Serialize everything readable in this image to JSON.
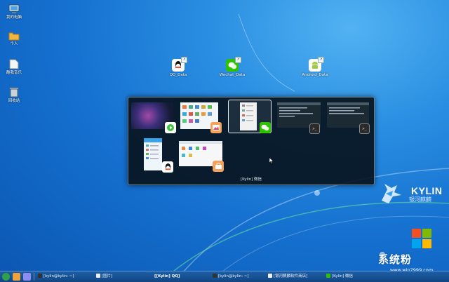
{
  "desktop": {
    "icons": [
      {
        "label": "我的电脑"
      },
      {
        "label": "个人"
      },
      {
        "label": "酷我音乐"
      },
      {
        "label": "回收站"
      },
      {
        "label": "QQ_Data"
      },
      {
        "label": "Wechat_Data"
      },
      {
        "label": "Android_Data"
      }
    ]
  },
  "switcher": {
    "caption": "[Kylin] 微信"
  },
  "brand": {
    "name": "KYLIN",
    "subtitle": "银河麒麟"
  },
  "watermark": {
    "title": "系统粉",
    "url": "www.win7999.com"
  },
  "taskbar": {
    "tasks": [
      {
        "label": "[kylin@kylin: ~]"
      },
      {
        "label": "[图片]"
      },
      {
        "label": "[[Kylin] QQ]"
      },
      {
        "label": "[kylin@kylin: ~]"
      },
      {
        "label": "[银河麒麟软件商店]"
      },
      {
        "label": "[Kylin] 微信"
      }
    ]
  },
  "colors": {
    "wechat": "#2dc100",
    "android": "#9ccc3a",
    "qq": "#111111",
    "accent": "#2a8fe2"
  }
}
